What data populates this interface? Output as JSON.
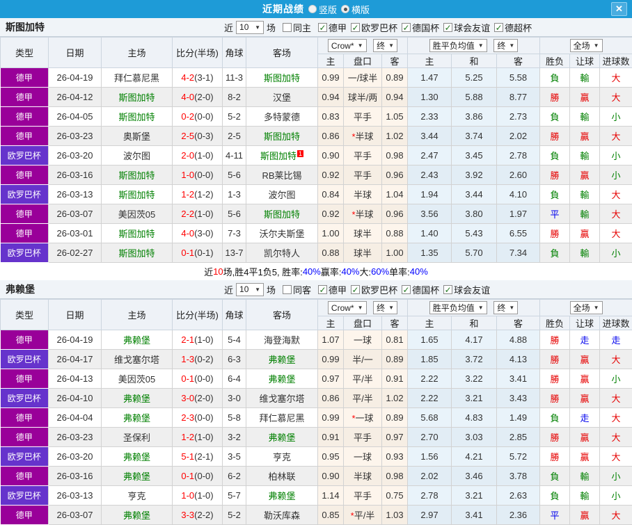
{
  "topbar": {
    "title": "近期战绩",
    "vertical_label": "竖版",
    "horizontal_label": "横版"
  },
  "icons": {
    "close_glyph": "✕",
    "dropdown_arrow": "▼",
    "check_glyph": "✓"
  },
  "filters": {
    "near_label": "近",
    "games_label": "场"
  },
  "table_header": {
    "type": "类型",
    "date": "日期",
    "home": "主场",
    "score": "比分(半场)",
    "corner": "角球",
    "away": "客场",
    "odds_source": "Crow*",
    "final_label": "终",
    "avg_label": "胜平负均值",
    "full_label": "全场",
    "sub": [
      "主",
      "盘口",
      "客",
      "主",
      "和",
      "客",
      "胜负",
      "让球",
      "进球数"
    ]
  },
  "league_colors": {
    "德甲": "#990099",
    "欧罗巴杯": "#6633cc"
  },
  "result_colors": {
    "r": "#e60000",
    "g": "#008000",
    "b": "#0000ee"
  },
  "sections": [
    {
      "team": "斯图加特",
      "near_count": "10",
      "same_label": "同主",
      "same_checked": false,
      "leagues": [
        "德甲",
        "欧罗巴杯",
        "德国杯",
        "球会友谊",
        "德超杯"
      ],
      "rows": [
        {
          "league": "德甲",
          "date": "26-04-19",
          "home": "拜仁慕尼黑",
          "home_hl": false,
          "score": "4-2",
          "half": "(3-1)",
          "corner": "11-3",
          "away": "斯图加特",
          "away_hl": true,
          "odds": [
            "0.99",
            "一/球半",
            "0.89"
          ],
          "avg": [
            "1.47",
            "5.25",
            "5.58"
          ],
          "results": [
            [
              "負",
              "g"
            ],
            [
              "輸",
              "g"
            ],
            [
              "大",
              "r"
            ]
          ]
        },
        {
          "league": "德甲",
          "date": "26-04-12",
          "home": "斯图加特",
          "home_hl": true,
          "score": "4-0",
          "half": "(2-0)",
          "corner": "8-2",
          "away": "汉堡",
          "away_hl": false,
          "odds": [
            "0.94",
            "球半/两",
            "0.94"
          ],
          "avg": [
            "1.30",
            "5.88",
            "8.77"
          ],
          "results": [
            [
              "勝",
              "r"
            ],
            [
              "贏",
              "r"
            ],
            [
              "大",
              "r"
            ]
          ]
        },
        {
          "league": "德甲",
          "date": "26-04-05",
          "home": "斯图加特",
          "home_hl": true,
          "score": "0-2",
          "half": "(0-0)",
          "corner": "5-2",
          "away": "多特蒙德",
          "away_hl": false,
          "odds": [
            "0.83",
            "平手",
            "1.05"
          ],
          "avg": [
            "2.33",
            "3.86",
            "2.73"
          ],
          "results": [
            [
              "負",
              "g"
            ],
            [
              "輸",
              "g"
            ],
            [
              "小",
              "g"
            ]
          ]
        },
        {
          "league": "德甲",
          "date": "26-03-23",
          "home": "奥斯堡",
          "home_hl": false,
          "score": "2-5",
          "half": "(0-3)",
          "corner": "2-5",
          "away": "斯图加特",
          "away_hl": true,
          "odds": [
            "0.86",
            "*半球",
            "1.02"
          ],
          "avg": [
            "3.44",
            "3.74",
            "2.02"
          ],
          "results": [
            [
              "勝",
              "r"
            ],
            [
              "贏",
              "r"
            ],
            [
              "大",
              "r"
            ]
          ]
        },
        {
          "league": "欧罗巴杯",
          "date": "26-03-20",
          "home": "波尔图",
          "home_hl": false,
          "score": "2-0",
          "half": "(1-0)",
          "corner": "4-11",
          "away": "斯图加特",
          "away_hl": true,
          "badge": "1",
          "odds": [
            "0.90",
            "平手",
            "0.98"
          ],
          "avg": [
            "2.47",
            "3.45",
            "2.78"
          ],
          "results": [
            [
              "負",
              "g"
            ],
            [
              "輸",
              "g"
            ],
            [
              "小",
              "g"
            ]
          ]
        },
        {
          "league": "德甲",
          "date": "26-03-16",
          "home": "斯图加特",
          "home_hl": true,
          "score": "1-0",
          "half": "(0-0)",
          "corner": "5-6",
          "away": "RB莱比锡",
          "away_hl": false,
          "odds": [
            "0.92",
            "平手",
            "0.96"
          ],
          "avg": [
            "2.43",
            "3.92",
            "2.60"
          ],
          "results": [
            [
              "勝",
              "r"
            ],
            [
              "贏",
              "r"
            ],
            [
              "小",
              "g"
            ]
          ]
        },
        {
          "league": "欧罗巴杯",
          "date": "26-03-13",
          "home": "斯图加特",
          "home_hl": true,
          "score": "1-2",
          "half": "(1-2)",
          "corner": "1-3",
          "away": "波尔图",
          "away_hl": false,
          "odds": [
            "0.84",
            "半球",
            "1.04"
          ],
          "avg": [
            "1.94",
            "3.44",
            "4.10"
          ],
          "results": [
            [
              "負",
              "g"
            ],
            [
              "輸",
              "g"
            ],
            [
              "大",
              "r"
            ]
          ]
        },
        {
          "league": "德甲",
          "date": "26-03-07",
          "home": "美因茨05",
          "home_hl": false,
          "score": "2-2",
          "half": "(1-0)",
          "corner": "5-6",
          "away": "斯图加特",
          "away_hl": true,
          "odds": [
            "0.92",
            "*半球",
            "0.96"
          ],
          "avg": [
            "3.56",
            "3.80",
            "1.97"
          ],
          "results": [
            [
              "平",
              "b"
            ],
            [
              "輸",
              "g"
            ],
            [
              "大",
              "r"
            ]
          ]
        },
        {
          "league": "德甲",
          "date": "26-03-01",
          "home": "斯图加特",
          "home_hl": true,
          "score": "4-0",
          "half": "(3-0)",
          "corner": "7-3",
          "away": "沃尔夫斯堡",
          "away_hl": false,
          "odds": [
            "1.00",
            "球半",
            "0.88"
          ],
          "avg": [
            "1.40",
            "5.43",
            "6.55"
          ],
          "results": [
            [
              "勝",
              "r"
            ],
            [
              "贏",
              "r"
            ],
            [
              "大",
              "r"
            ]
          ]
        },
        {
          "league": "欧罗巴杯",
          "date": "26-02-27",
          "home": "斯图加特",
          "home_hl": true,
          "score": "0-1",
          "half": "(0-1)",
          "corner": "13-7",
          "away": "凯尔特人",
          "away_hl": false,
          "odds": [
            "0.88",
            "球半",
            "1.00"
          ],
          "avg": [
            "1.35",
            "5.70",
            "7.34"
          ],
          "results": [
            [
              "負",
              "g"
            ],
            [
              "輸",
              "g"
            ],
            [
              "小",
              "g"
            ]
          ]
        }
      ],
      "summary": [
        [
          "近",
          "k"
        ],
        [
          "10",
          "r"
        ],
        [
          "场,胜4平1负5, 胜率:",
          "k"
        ],
        [
          "40%",
          "b"
        ],
        [
          " 赢率:",
          "k"
        ],
        [
          "40%",
          "b"
        ],
        [
          " 大:",
          "k"
        ],
        [
          "60%",
          "b"
        ],
        [
          " 单率:",
          "k"
        ],
        [
          "40%",
          "b"
        ]
      ]
    },
    {
      "team": "弗赖堡",
      "near_count": "10",
      "same_label": "同客",
      "same_checked": false,
      "leagues": [
        "德甲",
        "欧罗巴杯",
        "德国杯",
        "球会友谊"
      ],
      "rows": [
        {
          "league": "德甲",
          "date": "26-04-19",
          "home": "弗赖堡",
          "home_hl": true,
          "score": "2-1",
          "half": "(1-0)",
          "corner": "5-4",
          "away": "海登海默",
          "away_hl": false,
          "odds": [
            "1.07",
            "一球",
            "0.81"
          ],
          "avg": [
            "1.65",
            "4.17",
            "4.88"
          ],
          "results": [
            [
              "勝",
              "r"
            ],
            [
              "走",
              "b"
            ],
            [
              "走",
              "b"
            ]
          ]
        },
        {
          "league": "欧罗巴杯",
          "date": "26-04-17",
          "home": "维戈塞尔塔",
          "home_hl": false,
          "score": "1-3",
          "half": "(0-2)",
          "corner": "6-3",
          "away": "弗赖堡",
          "away_hl": true,
          "odds": [
            "0.99",
            "半/一",
            "0.89"
          ],
          "avg": [
            "1.85",
            "3.72",
            "4.13"
          ],
          "results": [
            [
              "勝",
              "r"
            ],
            [
              "贏",
              "r"
            ],
            [
              "大",
              "r"
            ]
          ]
        },
        {
          "league": "德甲",
          "date": "26-04-13",
          "home": "美因茨05",
          "home_hl": false,
          "score": "0-1",
          "half": "(0-0)",
          "corner": "6-4",
          "away": "弗赖堡",
          "away_hl": true,
          "odds": [
            "0.97",
            "平/半",
            "0.91"
          ],
          "avg": [
            "2.22",
            "3.22",
            "3.41"
          ],
          "results": [
            [
              "勝",
              "r"
            ],
            [
              "贏",
              "r"
            ],
            [
              "小",
              "g"
            ]
          ]
        },
        {
          "league": "欧罗巴杯",
          "date": "26-04-10",
          "home": "弗赖堡",
          "home_hl": true,
          "score": "3-0",
          "half": "(2-0)",
          "corner": "3-0",
          "away": "维戈塞尔塔",
          "away_hl": false,
          "odds": [
            "0.86",
            "平/半",
            "1.02"
          ],
          "avg": [
            "2.22",
            "3.21",
            "3.43"
          ],
          "results": [
            [
              "勝",
              "r"
            ],
            [
              "贏",
              "r"
            ],
            [
              "大",
              "r"
            ]
          ]
        },
        {
          "league": "德甲",
          "date": "26-04-04",
          "home": "弗赖堡",
          "home_hl": true,
          "score": "2-3",
          "half": "(0-0)",
          "corner": "5-8",
          "away": "拜仁慕尼黑",
          "away_hl": false,
          "odds": [
            "0.99",
            "*一球",
            "0.89"
          ],
          "avg": [
            "5.68",
            "4.83",
            "1.49"
          ],
          "results": [
            [
              "負",
              "g"
            ],
            [
              "走",
              "b"
            ],
            [
              "大",
              "r"
            ]
          ]
        },
        {
          "league": "德甲",
          "date": "26-03-23",
          "home": "圣保利",
          "home_hl": false,
          "score": "1-2",
          "half": "(1-0)",
          "corner": "3-2",
          "away": "弗赖堡",
          "away_hl": true,
          "odds": [
            "0.91",
            "平手",
            "0.97"
          ],
          "avg": [
            "2.70",
            "3.03",
            "2.85"
          ],
          "results": [
            [
              "勝",
              "r"
            ],
            [
              "贏",
              "r"
            ],
            [
              "大",
              "r"
            ]
          ]
        },
        {
          "league": "欧罗巴杯",
          "date": "26-03-20",
          "home": "弗赖堡",
          "home_hl": true,
          "score": "5-1",
          "half": "(2-1)",
          "corner": "3-5",
          "away": "亨克",
          "away_hl": false,
          "odds": [
            "0.95",
            "一球",
            "0.93"
          ],
          "avg": [
            "1.56",
            "4.21",
            "5.72"
          ],
          "results": [
            [
              "勝",
              "r"
            ],
            [
              "贏",
              "r"
            ],
            [
              "大",
              "r"
            ]
          ]
        },
        {
          "league": "德甲",
          "date": "26-03-16",
          "home": "弗赖堡",
          "home_hl": true,
          "score": "0-1",
          "half": "(0-0)",
          "corner": "6-2",
          "away": "柏林联",
          "away_hl": false,
          "odds": [
            "0.90",
            "半球",
            "0.98"
          ],
          "avg": [
            "2.02",
            "3.46",
            "3.78"
          ],
          "results": [
            [
              "負",
              "g"
            ],
            [
              "輸",
              "g"
            ],
            [
              "小",
              "g"
            ]
          ]
        },
        {
          "league": "欧罗巴杯",
          "date": "26-03-13",
          "home": "亨克",
          "home_hl": false,
          "score": "1-0",
          "half": "(1-0)",
          "corner": "5-7",
          "away": "弗赖堡",
          "away_hl": true,
          "odds": [
            "1.14",
            "平手",
            "0.75"
          ],
          "avg": [
            "2.78",
            "3.21",
            "2.63"
          ],
          "results": [
            [
              "負",
              "g"
            ],
            [
              "輸",
              "g"
            ],
            [
              "小",
              "g"
            ]
          ]
        },
        {
          "league": "德甲",
          "date": "26-03-07",
          "home": "弗赖堡",
          "home_hl": true,
          "score": "3-3",
          "half": "(2-2)",
          "corner": "5-2",
          "away": "勒沃库森",
          "away_hl": false,
          "odds": [
            "0.85",
            "*平/半",
            "1.03"
          ],
          "avg": [
            "2.97",
            "3.41",
            "2.36"
          ],
          "results": [
            [
              "平",
              "b"
            ],
            [
              "贏",
              "r"
            ],
            [
              "大",
              "r"
            ]
          ]
        }
      ],
      "summary": null
    }
  ]
}
